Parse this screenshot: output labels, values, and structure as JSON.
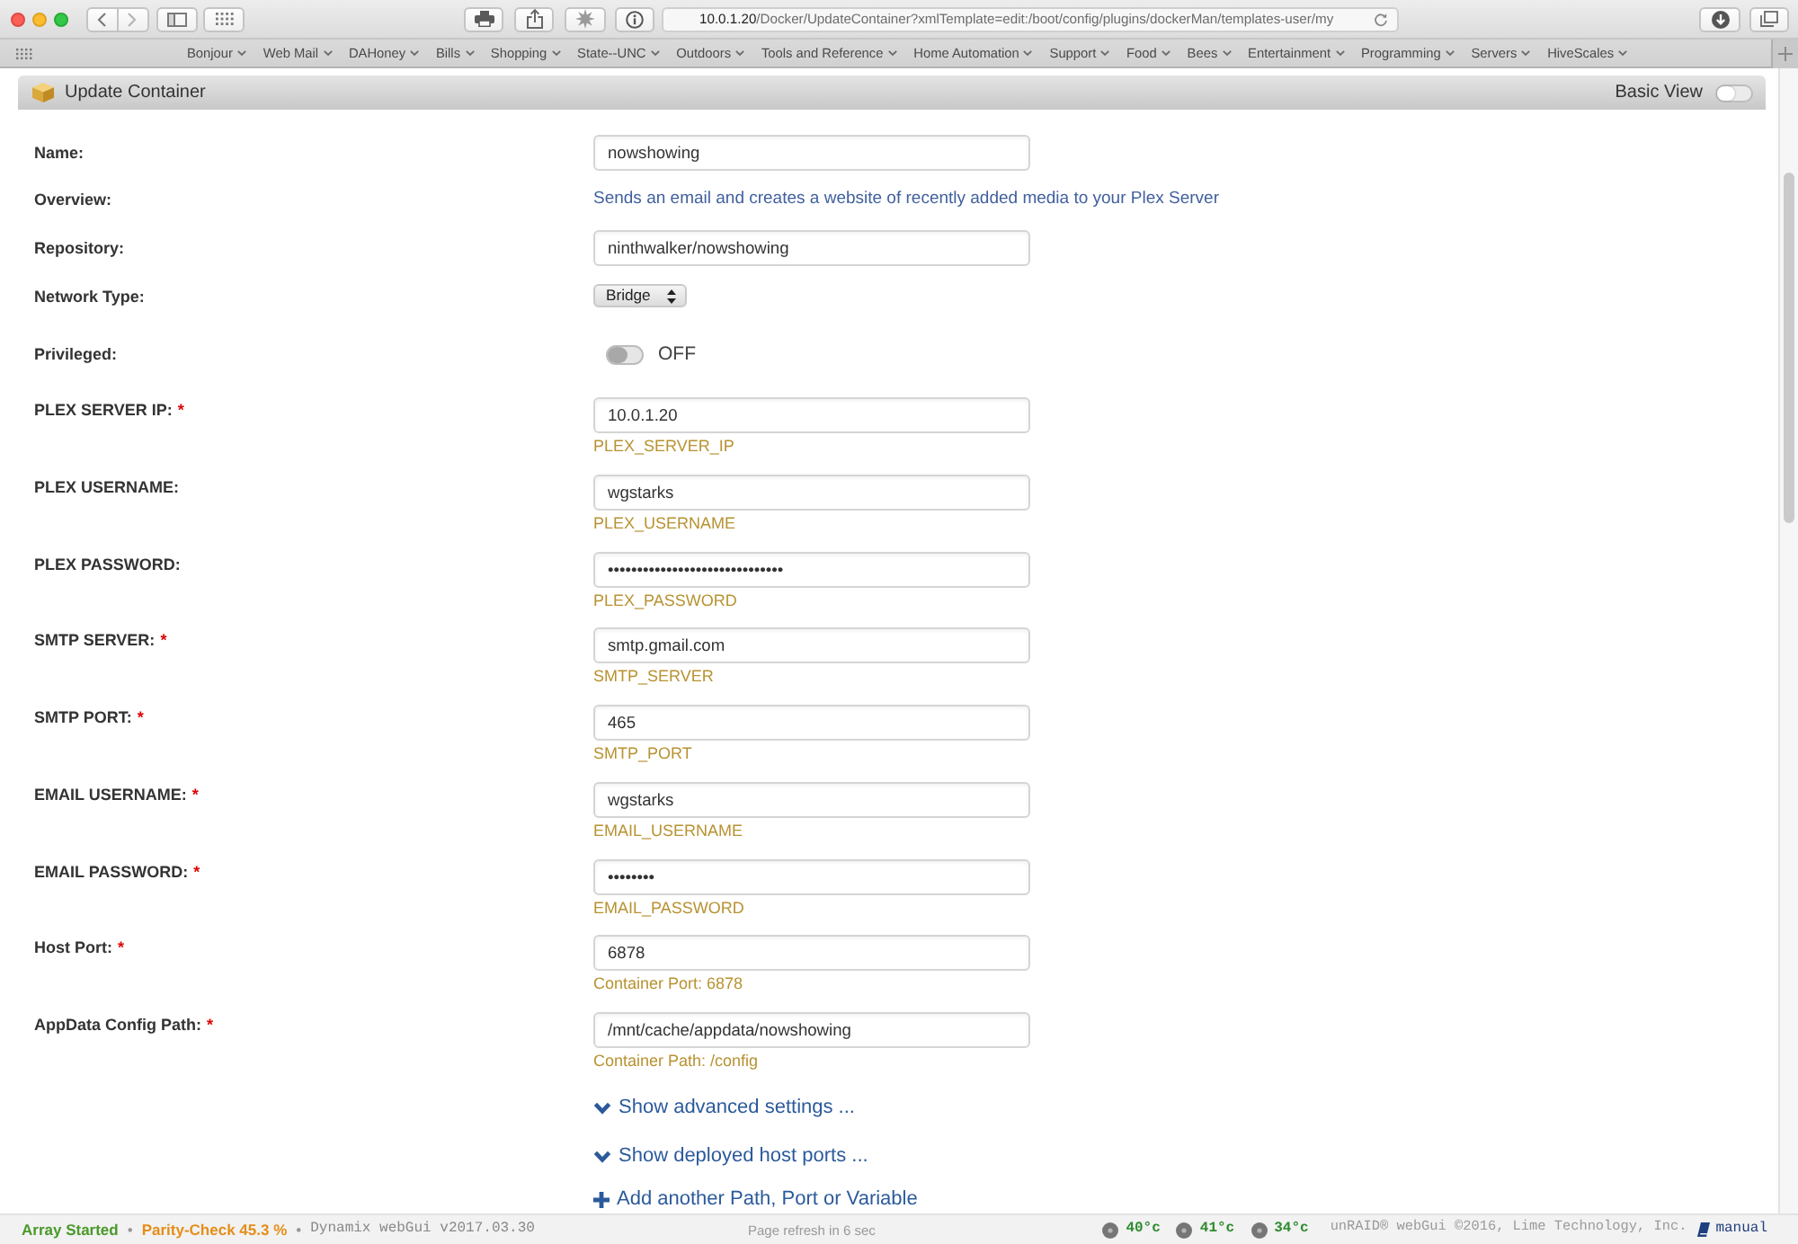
{
  "browser": {
    "url": {
      "host": "10.0.1.20",
      "path": "/Docker/UpdateContainer?xmlTemplate=edit:/boot/config/plugins/dockerMan/templates-user/my"
    },
    "bookmarks": [
      "Bonjour",
      "Web Mail",
      "DAHoney",
      "Bills",
      "Shopping",
      "State--UNC",
      "Outdoors",
      "Tools and Reference",
      "Home Automation",
      "Support",
      "Food",
      "Bees",
      "Entertainment",
      "Programming",
      "Servers",
      "HiveScales"
    ]
  },
  "panel": {
    "title": "Update Container",
    "view_toggle": {
      "label": "Basic View",
      "on": false
    }
  },
  "fields": [
    {
      "kind": "text",
      "label": "Name:",
      "value": "nowshowing"
    },
    {
      "kind": "description",
      "label": "Overview:",
      "text": "Sends an email and creates a website of recently added media to your Plex Server"
    },
    {
      "kind": "text",
      "label": "Repository:",
      "value": "ninthwalker/nowshowing"
    },
    {
      "kind": "select",
      "label": "Network Type:",
      "value": "Bridge"
    },
    {
      "kind": "toggle",
      "label": "Privileged:",
      "on": false,
      "state_text": "OFF"
    },
    {
      "kind": "text",
      "label": "PLEX SERVER IP:",
      "required_mark": "*",
      "value": "10.0.1.20",
      "hint": "PLEX_SERVER_IP"
    },
    {
      "kind": "text",
      "label": "PLEX USERNAME:",
      "value": "wgstarks",
      "hint": "PLEX_USERNAME"
    },
    {
      "kind": "text",
      "label": "PLEX PASSWORD:",
      "value": "••••••••••••••••••••••••••••••",
      "hint": "PLEX_PASSWORD"
    },
    {
      "kind": "text",
      "label": "SMTP SERVER:",
      "required_mark": "*",
      "value": "smtp.gmail.com",
      "hint": "SMTP_SERVER"
    },
    {
      "kind": "text",
      "label": "SMTP PORT:",
      "required_mark": "*",
      "value": "465",
      "hint": "SMTP_PORT"
    },
    {
      "kind": "text",
      "label": "EMAIL USERNAME:",
      "required_mark": "*",
      "value": "wgstarks",
      "hint": "EMAIL_USERNAME"
    },
    {
      "kind": "text",
      "label": "EMAIL PASSWORD:",
      "required_mark": "*",
      "value": "••••••••",
      "hint": "EMAIL_PASSWORD"
    },
    {
      "kind": "text",
      "label": "Host Port:",
      "required_mark": "*",
      "value": "6878",
      "hint": "Container Port: 6878"
    },
    {
      "kind": "text",
      "label": "AppData Config Path:",
      "required_mark": "*",
      "value": "/mnt/cache/appdata/nowshowing",
      "hint": "Container Path: /config"
    }
  ],
  "actions": [
    {
      "kind": "expand",
      "text": "Show advanced settings ..."
    },
    {
      "kind": "expand",
      "text": "Show deployed host ports ..."
    },
    {
      "kind": "add",
      "text": "Add another Path, Port or Variable"
    }
  ],
  "status_bar": {
    "left": [
      {
        "kind": "ok",
        "text": "Array Started"
      },
      {
        "kind": "separator",
        "text": "•"
      },
      {
        "kind": "warning",
        "text": "Parity-Check 45.3 %"
      },
      {
        "kind": "separator",
        "text": "•"
      },
      {
        "kind": "version",
        "text": "Dynamix webGui v2017.03.30"
      }
    ],
    "refresh": "Page refresh in 6 sec",
    "temperatures": [
      "40°c",
      "41°c",
      "34°c"
    ],
    "copyright": "unRAID® webGui ©2016, Lime Technology, Inc.",
    "manual": "manual"
  }
}
